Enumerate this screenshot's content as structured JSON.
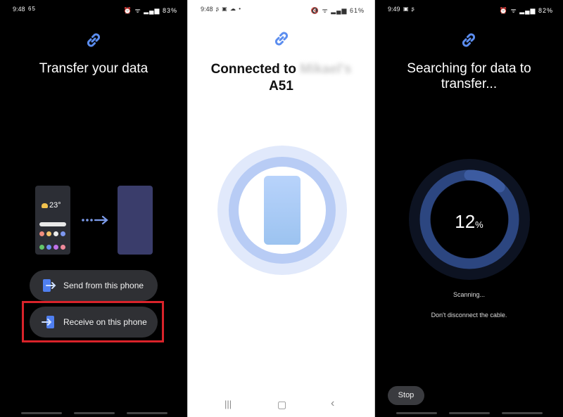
{
  "screen1": {
    "status": {
      "time": "9:48",
      "left_icons": "65",
      "battery": "83%"
    },
    "title": "Transfer your data",
    "illustration": {
      "temperature": "23°"
    },
    "send_button": "Send from this phone",
    "receive_button": "Receive on this phone",
    "highlighted": "receive_button"
  },
  "screen2": {
    "status": {
      "time": "9:48",
      "battery": "61%"
    },
    "title_prefix": "Connected to",
    "title_device_blurred": "Mikael's",
    "title_model": "A51"
  },
  "screen3": {
    "status": {
      "time": "9:49",
      "battery": "82%"
    },
    "title_line1": "Searching for data to",
    "title_line2": "transfer...",
    "progress_value": "12",
    "progress_unit": "%",
    "progress_fraction": 0.12,
    "scanning_text": "Scanning...",
    "cable_text": "Don't disconnect the cable.",
    "stop_button": "Stop"
  },
  "colors": {
    "link_icon": "#5b8def",
    "highlight_border": "#d9232a",
    "progress_ring": "#2c4680",
    "progress_ring_outer": "#141a2c"
  }
}
